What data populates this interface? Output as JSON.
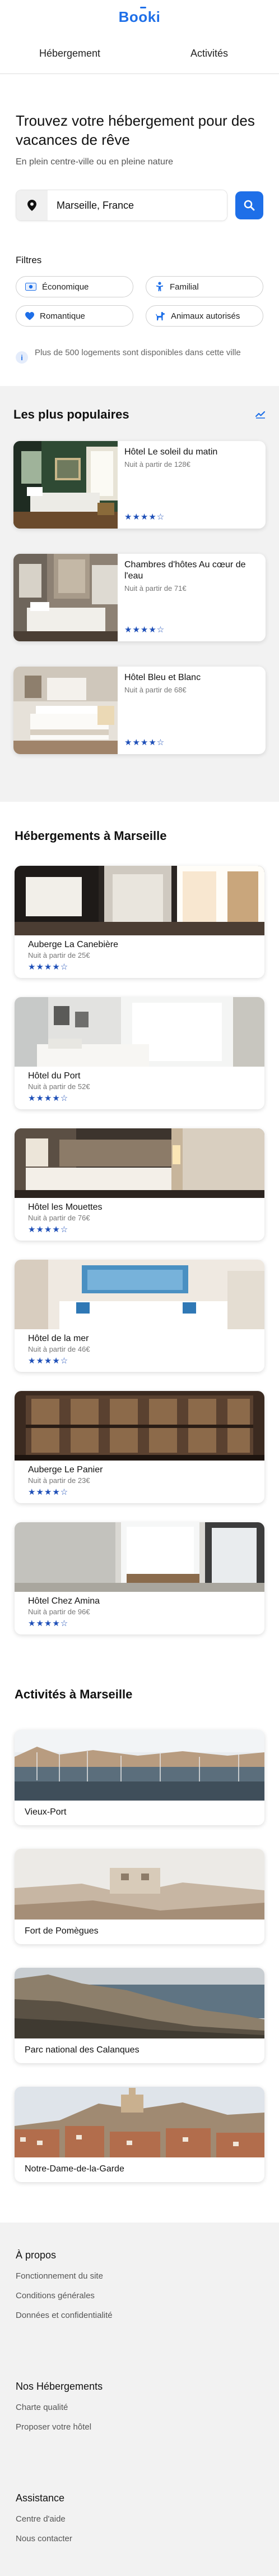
{
  "app": {
    "logo": "Booki"
  },
  "nav": {
    "tabs": [
      {
        "label": "Hébergement"
      },
      {
        "label": "Activités"
      }
    ]
  },
  "search": {
    "title": "Trouvez votre hébergement pour des vacances de rêve",
    "subtitle": "En plein centre-ville ou en pleine nature",
    "input_value": "Marseille, France",
    "location_icon": "location-pin-icon",
    "submit_icon": "search-icon",
    "filters_title": "Filtres",
    "filters": [
      {
        "label": "Économique",
        "icon": "money-icon"
      },
      {
        "label": "Familial",
        "icon": "child-icon"
      },
      {
        "label": "Romantique",
        "icon": "heart-icon"
      },
      {
        "label": "Animaux autorisés",
        "icon": "dog-icon"
      }
    ],
    "info_icon": "info-icon",
    "info_text": "Plus de 500 logements sont disponibles dans cette ville"
  },
  "popular": {
    "title": "Les plus populaires",
    "trend_icon": "chart-line-icon",
    "items": [
      {
        "name": "Hôtel Le soleil du matin",
        "price": "Nuit à partir de 128€",
        "stars": "★★★★☆",
        "rating": 4
      },
      {
        "name": "Chambres d'hôtes Au cœur de l'eau",
        "price": "Nuit à partir de 71€",
        "stars": "★★★★☆",
        "rating": 4
      },
      {
        "name": "Hôtel Bleu et Blanc",
        "price": "Nuit à partir de 68€",
        "stars": "★★★★☆",
        "rating": 4
      }
    ]
  },
  "hotels": {
    "title": "Hébergements à Marseille",
    "items": [
      {
        "name": "Auberge La Canebière",
        "price": "Nuit à partir de 25€",
        "stars": "★★★★☆",
        "rating": 4
      },
      {
        "name": "Hôtel du Port",
        "price": "Nuit à partir de 52€",
        "stars": "★★★★☆",
        "rating": 4
      },
      {
        "name": "Hôtel les Mouettes",
        "price": "Nuit à partir de 76€",
        "stars": "★★★★☆",
        "rating": 4
      },
      {
        "name": "Hôtel de la mer",
        "price": "Nuit à partir de 46€",
        "stars": "★★★★☆",
        "rating": 4
      },
      {
        "name": "Auberge Le Panier",
        "price": "Nuit à partir de 23€",
        "stars": "★★★★☆",
        "rating": 4
      },
      {
        "name": "Hôtel Chez Amina",
        "price": "Nuit à partir de 96€",
        "stars": "★★★★☆",
        "rating": 4
      }
    ]
  },
  "activities": {
    "title": "Activités à Marseille",
    "items": [
      {
        "name": "Vieux-Port"
      },
      {
        "name": "Fort de Pomègues"
      },
      {
        "name": "Parc national des Calanques"
      },
      {
        "name": "Notre-Dame-de-la-Garde"
      }
    ]
  },
  "footer": {
    "groups": [
      {
        "title": "À propos",
        "links": [
          "Fonctionnement du site",
          "Conditions générales",
          "Données et confidentialité"
        ]
      },
      {
        "title": "Nos Hébergements",
        "links": [
          "Charte qualité",
          "Proposer votre hôtel"
        ]
      },
      {
        "title": "Assistance",
        "links": [
          "Centre d'aide",
          "Nous contacter"
        ]
      }
    ]
  },
  "colors": {
    "brand": "#1e6fe8",
    "stars": "#1e4fb8",
    "section_bg": "#f2f2f2"
  }
}
